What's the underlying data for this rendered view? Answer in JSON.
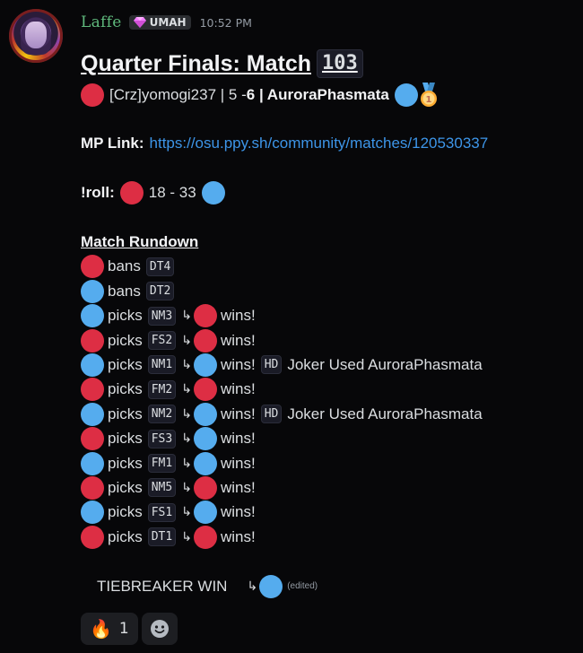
{
  "message": {
    "username": "Laffe",
    "tag": "UMAH",
    "timestamp": "10:52 PM",
    "edited": "(edited)"
  },
  "title": {
    "text": "Quarter Finals: Match",
    "match_number": "103"
  },
  "score_line": {
    "player_red": "[Crz]yomogi237 | 5 - ",
    "score_blue": "6",
    "player_blue": " | AuroraPhasmata"
  },
  "mp_link": {
    "label": "MP Link:",
    "url": "https://osu.ppy.sh/community/matches/120530337"
  },
  "roll": {
    "label": "!roll:",
    "values": "18 - 33"
  },
  "rundown_heading": "Match Rundown",
  "rundown": [
    {
      "team": "red",
      "action": "bans",
      "map": "DT4"
    },
    {
      "team": "blue",
      "action": "bans",
      "map": "DT2"
    },
    {
      "team": "blue",
      "action": "picks",
      "map": "NM3",
      "winner": "red",
      "result": "wins!"
    },
    {
      "team": "red",
      "action": "picks",
      "map": "FS2",
      "winner": "red",
      "result": "wins!"
    },
    {
      "team": "blue",
      "action": "picks",
      "map": "NM1",
      "winner": "blue",
      "result": "wins!",
      "mod": "HD",
      "note": "Joker Used AuroraPhasmata"
    },
    {
      "team": "red",
      "action": "picks",
      "map": "FM2",
      "winner": "red",
      "result": "wins!"
    },
    {
      "team": "blue",
      "action": "picks",
      "map": "NM2",
      "winner": "blue",
      "result": "wins!",
      "mod": "HD",
      "note": "Joker Used AuroraPhasmata"
    },
    {
      "team": "red",
      "action": "picks",
      "map": "FS3",
      "winner": "blue",
      "result": "wins!"
    },
    {
      "team": "blue",
      "action": "picks",
      "map": "FM1",
      "winner": "blue",
      "result": "wins!"
    },
    {
      "team": "red",
      "action": "picks",
      "map": "NM5",
      "winner": "red",
      "result": "wins!"
    },
    {
      "team": "blue",
      "action": "picks",
      "map": "FS1",
      "winner": "blue",
      "result": "wins!"
    },
    {
      "team": "red",
      "action": "picks",
      "map": "DT1",
      "winner": "red",
      "result": "wins!"
    }
  ],
  "tiebreaker": {
    "text": "TIEBREAKER WIN",
    "winner": "blue"
  },
  "arrow_glyph": "↳",
  "reactions": [
    {
      "icon": "fire-icon",
      "emoji": "🔥",
      "count": "1"
    },
    {
      "icon": "add-reaction-icon"
    }
  ],
  "colors": {
    "red_team": "#dd2e44",
    "blue_team": "#55acee",
    "username": "#5fb87c",
    "link": "#3d95e8"
  }
}
